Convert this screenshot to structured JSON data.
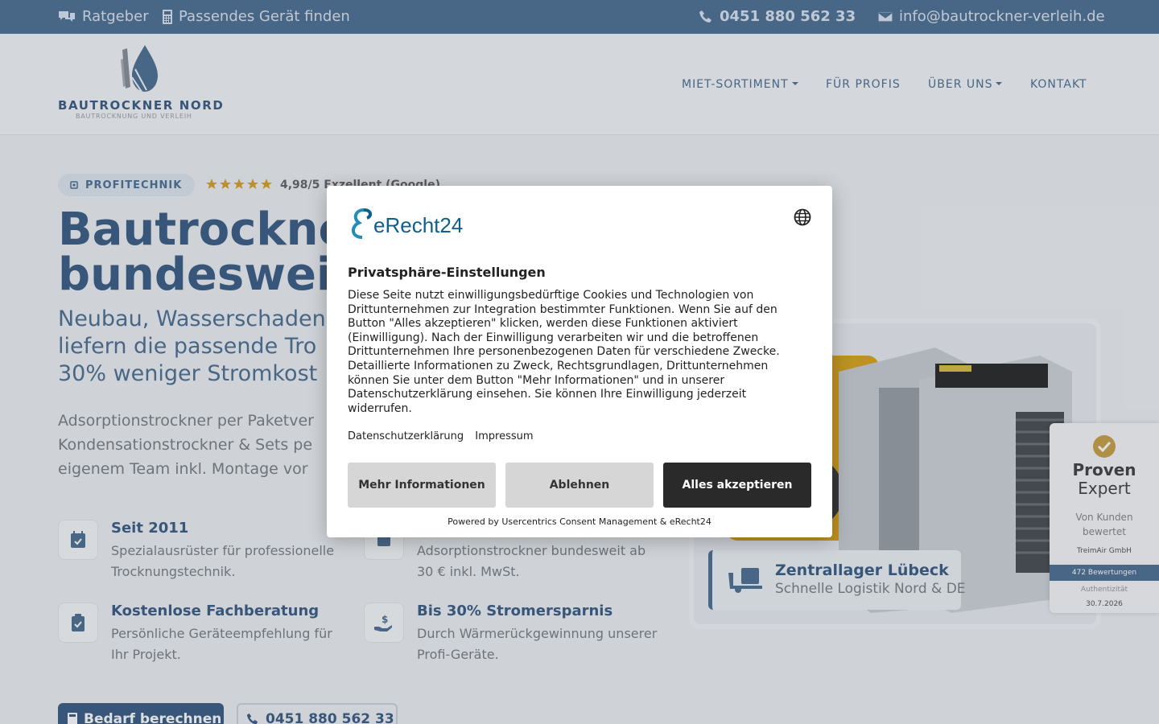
{
  "topbar": {
    "guide": "Ratgeber",
    "finder": "Passendes Gerät finden",
    "phone": "0451 880 562 33",
    "email": "info@bautrockner-verleih.de"
  },
  "header": {
    "brand": "BAUTROCKNER NORD",
    "brand_sub": "BAUTROCKNUNG UND VERLEIH",
    "nav": {
      "rent": "MIET-SORTIMENT",
      "pros": "FÜR PROFIS",
      "about": "ÜBER UNS",
      "contact": "KONTAKT"
    }
  },
  "hero": {
    "badge": "PROFITECHNIK",
    "rating_text": "4,98/5 Exzellent (Google)",
    "rating_stars": 5,
    "title_line1": "Bautrockne",
    "title_line2": "bundeswei",
    "lead_line1": "Neubau, Wasserschaden",
    "lead_line2": "liefern die passende Tro",
    "lead_line3": "30% weniger Stromkost",
    "body_line1": "Adsorptionstrockner per Paketver",
    "body_line2": "Kondensationstrockner & Sets pe",
    "body_line3": "eigenem Team inkl. Montage vor"
  },
  "features": [
    {
      "title": "Seit 2011",
      "desc": "Spezialausrüster für professionelle Trocknungstechnik.",
      "icon": "calendar-check-icon"
    },
    {
      "title": "",
      "desc": "Adsorptionstrockner bundesweit ab 30 € inkl. MwSt.",
      "icon": "box-icon"
    },
    {
      "title": "Kostenlose Fachberatung",
      "desc": "Persönliche Geräteempfehlung für Ihr Projekt.",
      "icon": "clipboard-check-icon"
    },
    {
      "title": "Bis 30% Stromersparnis",
      "desc": "Durch Wärmerückgewinnung unserer Profi-Geräte.",
      "icon": "hand-money-icon"
    }
  ],
  "cta": {
    "primary": "Bedarf berechnen",
    "secondary": "0451 880 562 33"
  },
  "location": {
    "title": "Zentrallager Lübeck",
    "subtitle": "Schnelle Logistik Nord & DE"
  },
  "proven_expert": {
    "brand_line1": "Proven",
    "brand_line2": "Expert",
    "tagline": "Von Kunden bewertet",
    "company": "TreimAir GmbH",
    "reviews": "472 Bewertungen",
    "auth_label": "Authentizität",
    "date": "30.7.2026"
  },
  "consent": {
    "logo_text": "eRecht24",
    "title": "Privatsphäre-Einstellungen",
    "description": "Diese Seite nutzt einwilligungsbedürftige Cookies und Technologien von Drittunternehmen zur Integration bestimmter Funktionen. Wenn Sie auf den Button \"Alles akzeptieren\" klicken, werden diese Funktionen aktiviert (Einwilligung). Nach der Einwilligung verarbeiten wir und die betroffenen Drittunternehmen Ihre personenbezogenen Daten für verschiedene Zwecke. Detaillierte Informationen zu Zweck, Rechtsgrundlagen, Drittunternehmen können Sie unter dem Button \"Mehr Informationen\" und in unserer Datenschutzerklärung einsehen. Sie können Ihre Einwilligung jederzeit widerrufen.",
    "link_privacy": "Datenschutzerklärung",
    "link_imprint": "Impressum",
    "btn_more": "Mehr Informationen",
    "btn_deny": "Ablehnen",
    "btn_accept": "Alles akzeptieren",
    "powered": "Powered by Usercentrics Consent Management & eRecht24"
  },
  "colors": {
    "primary": "#3c5f86",
    "topbar": "#4f7196",
    "star": "#d9a420",
    "accept": "#2a2a2a"
  }
}
